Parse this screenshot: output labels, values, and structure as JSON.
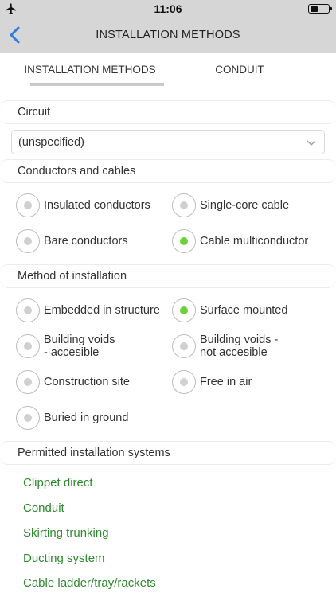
{
  "status_bar": {
    "time": "11:06"
  },
  "nav": {
    "title": "INSTALLATION METHODS"
  },
  "tabs": [
    {
      "label": "INSTALLATION METHODS",
      "active": true
    },
    {
      "label": "CONDUIT",
      "active": false
    }
  ],
  "circuit": {
    "header": "Circuit",
    "selected": "(unspecified)"
  },
  "conductors": {
    "header": "Conductors and cables",
    "options": [
      {
        "label": "Insulated conductors",
        "selected": false
      },
      {
        "label": "Single-core cable",
        "selected": false
      },
      {
        "label": "Bare conductors",
        "selected": false
      },
      {
        "label": "Cable multiconductor",
        "selected": true
      }
    ]
  },
  "method": {
    "header": "Method of installation",
    "options": [
      {
        "label": "Embedded in structure",
        "selected": false
      },
      {
        "label": "Surface mounted",
        "selected": true
      },
      {
        "label_line1": "Building voids",
        "label_line2": "- accesible",
        "selected": false
      },
      {
        "label_line1": "Building voids -",
        "label_line2": "not accesible",
        "selected": false
      },
      {
        "label": "Construction site",
        "selected": false
      },
      {
        "label": "Free in air",
        "selected": false
      },
      {
        "label": "Buried in ground",
        "selected": false
      }
    ]
  },
  "permitted": {
    "header": "Permitted installation systems",
    "items": [
      "Clippet direct",
      "Conduit",
      "Skirting trunking",
      "Ducting system",
      "Cable ladder/tray/rackets"
    ]
  },
  "colors": {
    "accent_green": "#6cd13b",
    "link_green": "#2e8a2e",
    "bar_gray": "#d6d6d6",
    "back_blue": "#2f7fe0"
  }
}
